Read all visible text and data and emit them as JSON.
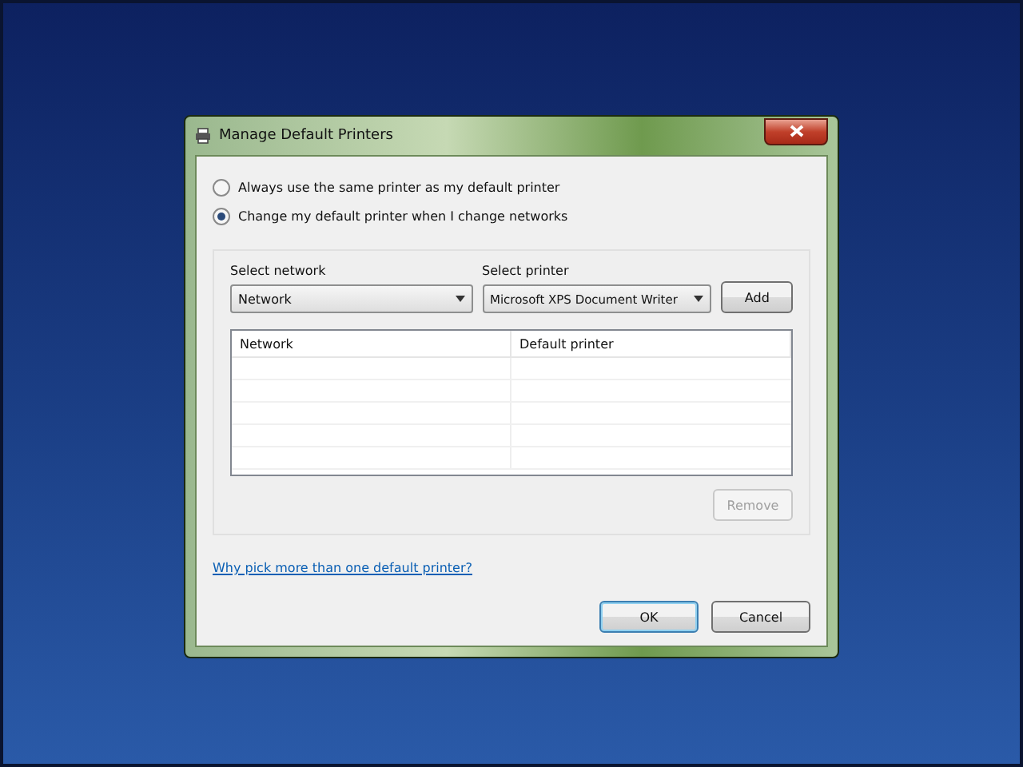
{
  "window": {
    "title": "Manage Default Printers"
  },
  "options": [
    {
      "label": "Always use the same printer as my default printer",
      "selected": false
    },
    {
      "label": "Change my default printer when I change networks",
      "selected": true
    }
  ],
  "network_select": {
    "label": "Select network",
    "value": "Network"
  },
  "printer_select": {
    "label": "Select printer",
    "value": "Microsoft XPS Document Writer"
  },
  "add_button": {
    "label": "Add",
    "disabled": false
  },
  "table": {
    "columns": [
      "Network",
      "Default printer"
    ]
  },
  "remove_button": {
    "label": "Remove",
    "disabled": true
  },
  "help_link": "Why pick more than one default printer?",
  "buttons": [
    {
      "label": "OK",
      "default": true
    },
    {
      "label": "Cancel",
      "default": false
    }
  ]
}
